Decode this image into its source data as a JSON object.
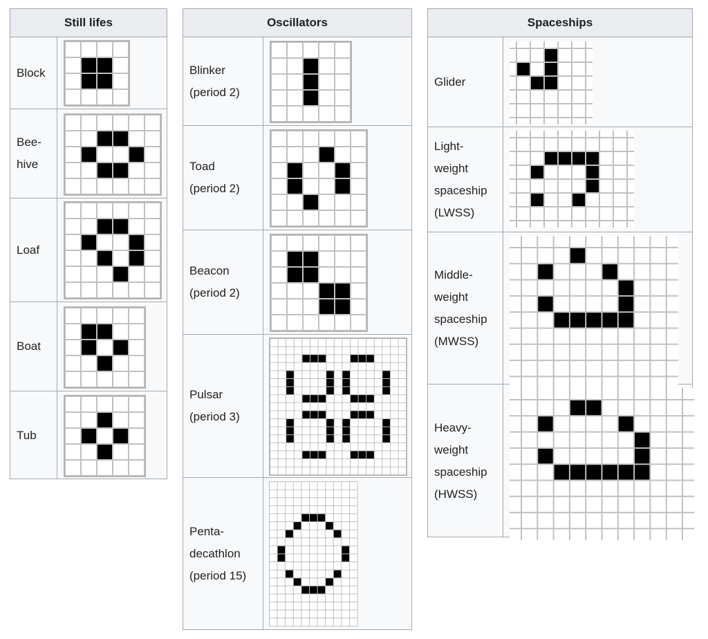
{
  "tables": [
    {
      "id": "still-lifes",
      "header": "Still lifes",
      "rows": [
        {
          "label": "Block",
          "pattern": {
            "cols": 4,
            "rows": 4,
            "live": [
              [
                1,
                1
              ],
              [
                1,
                2
              ],
              [
                2,
                1
              ],
              [
                2,
                2
              ]
            ]
          }
        },
        {
          "label": "Bee-\nhive",
          "pattern": {
            "cols": 6,
            "rows": 5,
            "live": [
              [
                1,
                2
              ],
              [
                1,
                3
              ],
              [
                2,
                1
              ],
              [
                2,
                4
              ],
              [
                3,
                2
              ],
              [
                3,
                3
              ]
            ]
          }
        },
        {
          "label": "Loaf",
          "pattern": {
            "cols": 6,
            "rows": 6,
            "live": [
              [
                1,
                2
              ],
              [
                1,
                3
              ],
              [
                2,
                1
              ],
              [
                2,
                4
              ],
              [
                3,
                2
              ],
              [
                3,
                4
              ],
              [
                4,
                3
              ]
            ]
          }
        },
        {
          "label": "Boat",
          "pattern": {
            "cols": 5,
            "rows": 5,
            "live": [
              [
                1,
                1
              ],
              [
                1,
                2
              ],
              [
                2,
                1
              ],
              [
                2,
                3
              ],
              [
                3,
                2
              ]
            ]
          }
        },
        {
          "label": "Tub",
          "pattern": {
            "cols": 5,
            "rows": 5,
            "live": [
              [
                1,
                2
              ],
              [
                2,
                1
              ],
              [
                2,
                3
              ],
              [
                3,
                2
              ]
            ]
          }
        }
      ]
    },
    {
      "id": "oscillators",
      "header": "Oscillators",
      "rows": [
        {
          "label": "Blinker\n(period 2)",
          "pattern": {
            "cols": 5,
            "rows": 5,
            "live": [
              [
                1,
                2
              ],
              [
                2,
                2
              ],
              [
                3,
                2
              ]
            ]
          }
        },
        {
          "label": "Toad\n(period 2)",
          "pattern": {
            "cols": 6,
            "rows": 6,
            "live": [
              [
                1,
                3
              ],
              [
                2,
                1
              ],
              [
                2,
                4
              ],
              [
                3,
                1
              ],
              [
                3,
                4
              ],
              [
                4,
                2
              ]
            ]
          }
        },
        {
          "label": "Beacon\n(period 2)",
          "pattern": {
            "cols": 6,
            "rows": 6,
            "live": [
              [
                1,
                1
              ],
              [
                1,
                2
              ],
              [
                2,
                1
              ],
              [
                2,
                2
              ],
              [
                3,
                3
              ],
              [
                3,
                4
              ],
              [
                4,
                3
              ],
              [
                4,
                4
              ]
            ]
          }
        },
        {
          "label": "Pulsar\n(period 3)",
          "pattern": {
            "cols": 17,
            "rows": 17,
            "live": [
              [
                2,
                4
              ],
              [
                2,
                5
              ],
              [
                2,
                6
              ],
              [
                2,
                10
              ],
              [
                2,
                11
              ],
              [
                2,
                12
              ],
              [
                4,
                2
              ],
              [
                4,
                7
              ],
              [
                4,
                9
              ],
              [
                4,
                14
              ],
              [
                5,
                2
              ],
              [
                5,
                7
              ],
              [
                5,
                9
              ],
              [
                5,
                14
              ],
              [
                6,
                2
              ],
              [
                6,
                7
              ],
              [
                6,
                9
              ],
              [
                6,
                14
              ],
              [
                7,
                4
              ],
              [
                7,
                5
              ],
              [
                7,
                6
              ],
              [
                7,
                10
              ],
              [
                7,
                11
              ],
              [
                7,
                12
              ],
              [
                9,
                4
              ],
              [
                9,
                5
              ],
              [
                9,
                6
              ],
              [
                9,
                10
              ],
              [
                9,
                11
              ],
              [
                9,
                12
              ],
              [
                10,
                2
              ],
              [
                10,
                7
              ],
              [
                10,
                9
              ],
              [
                10,
                14
              ],
              [
                11,
                2
              ],
              [
                11,
                7
              ],
              [
                11,
                9
              ],
              [
                11,
                14
              ],
              [
                12,
                2
              ],
              [
                12,
                7
              ],
              [
                12,
                9
              ],
              [
                12,
                14
              ],
              [
                14,
                4
              ],
              [
                14,
                5
              ],
              [
                14,
                6
              ],
              [
                14,
                10
              ],
              [
                14,
                11
              ],
              [
                14,
                12
              ]
            ]
          }
        },
        {
          "label": "Penta-\ndecathlon\n(period 15)",
          "pattern": {
            "cols": 11,
            "rows": 18,
            "live": [
              [
                4,
                4
              ],
              [
                4,
                5
              ],
              [
                4,
                6
              ],
              [
                5,
                3
              ],
              [
                5,
                7
              ],
              [
                6,
                2
              ],
              [
                6,
                8
              ],
              [
                8,
                1
              ],
              [
                8,
                9
              ],
              [
                9,
                1
              ],
              [
                9,
                9
              ],
              [
                11,
                2
              ],
              [
                11,
                8
              ],
              [
                12,
                3
              ],
              [
                12,
                7
              ],
              [
                13,
                4
              ],
              [
                13,
                5
              ],
              [
                13,
                6
              ]
            ]
          }
        }
      ]
    },
    {
      "id": "spaceships",
      "header": "Spaceships",
      "rows": [
        {
          "label": "Glider",
          "pattern": {
            "cols": 6,
            "rows": 6,
            "cropped": true,
            "live": [
              [
                1,
                3
              ],
              [
                2,
                1
              ],
              [
                2,
                3
              ],
              [
                3,
                2
              ],
              [
                3,
                3
              ]
            ]
          }
        },
        {
          "label": "Light-\nweight\nspaceship\n(LWSS)",
          "pattern": {
            "cols": 9,
            "rows": 7,
            "cropped": true,
            "live": [
              [
                2,
                3
              ],
              [
                2,
                4
              ],
              [
                2,
                5
              ],
              [
                2,
                6
              ],
              [
                3,
                2
              ],
              [
                3,
                6
              ],
              [
                4,
                6
              ],
              [
                5,
                2
              ],
              [
                5,
                5
              ]
            ]
          }
        },
        {
          "label": "Middle-\nweight\nspaceship\n(MWSS)",
          "pattern": {
            "cols": 10,
            "rows": 9,
            "cropped": true,
            "live": [
              [
                1,
                4
              ],
              [
                2,
                2
              ],
              [
                2,
                6
              ],
              [
                3,
                7
              ],
              [
                4,
                2
              ],
              [
                4,
                7
              ],
              [
                5,
                3
              ],
              [
                5,
                4
              ],
              [
                5,
                5
              ],
              [
                5,
                6
              ],
              [
                5,
                7
              ]
            ]
          }
        },
        {
          "label": "Heavy-\nweight\nspaceship\n(HWSS)",
          "pattern": {
            "cols": 11,
            "rows": 9,
            "cropped": true,
            "live": [
              [
                1,
                4
              ],
              [
                1,
                5
              ],
              [
                2,
                2
              ],
              [
                2,
                7
              ],
              [
                3,
                8
              ],
              [
                4,
                2
              ],
              [
                4,
                8
              ],
              [
                5,
                3
              ],
              [
                5,
                4
              ],
              [
                5,
                5
              ],
              [
                5,
                6
              ],
              [
                5,
                7
              ],
              [
                5,
                8
              ]
            ]
          }
        }
      ]
    }
  ],
  "colors": {
    "header_bg": "#eaecf0",
    "body_bg": "#f8f9fa",
    "border": "#a2a9b1",
    "grid_line": "#c0c0c0",
    "dead_cell": "#ffffff",
    "live_cell": "#000000"
  }
}
